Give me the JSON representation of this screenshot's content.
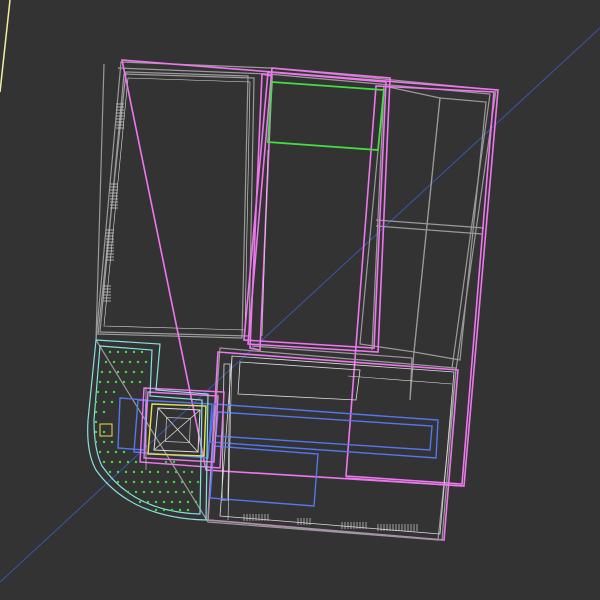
{
  "viewport": {
    "background": "#333333",
    "description_hidden": ""
  },
  "palette": {
    "pink": "#ee77ee",
    "magenta": "#cc55cc",
    "white": "#dddddd",
    "gray": "#9a9a9a",
    "cyan": "#88e0e0",
    "green": "#44dd44",
    "yellow": "#e8e055",
    "blue": "#5577ee",
    "axis_blue": "#3d55aa",
    "axis_yellow": "#f0f0a0"
  },
  "layers": [
    "walls",
    "rooms",
    "furniture",
    "stairs",
    "hatch",
    "axes"
  ]
}
